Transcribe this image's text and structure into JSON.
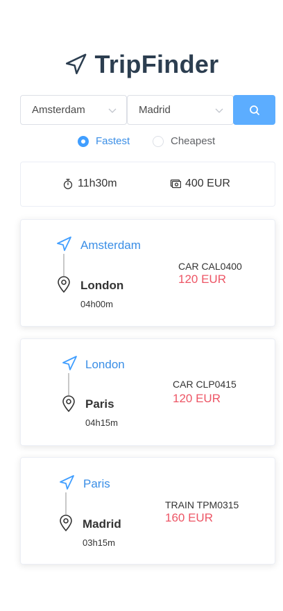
{
  "app": {
    "title": "TripFinder"
  },
  "search": {
    "from_value": "Amsterdam",
    "to_value": "Madrid"
  },
  "options": {
    "fastest_label": "Fastest",
    "cheapest_label": "Cheapest",
    "selected": "fastest"
  },
  "summary": {
    "duration": "11h30m",
    "total": "400 EUR"
  },
  "legs": [
    {
      "from": "Amsterdam",
      "to": "London",
      "duration": "04h00m",
      "reference": "CAR CAL0400",
      "price": "120 EUR"
    },
    {
      "from": "London",
      "to": "Paris",
      "duration": "04h15m",
      "reference": "CAR CLP0415",
      "price": "120 EUR"
    },
    {
      "from": "Paris",
      "to": "Madrid",
      "duration": "03h15m",
      "reference": "TRAIN TPM0315",
      "price": "160 EUR"
    }
  ],
  "colors": {
    "accent": "#409eff",
    "price": "#ed5565",
    "title": "#2c3e50",
    "button": "#5cadff"
  }
}
